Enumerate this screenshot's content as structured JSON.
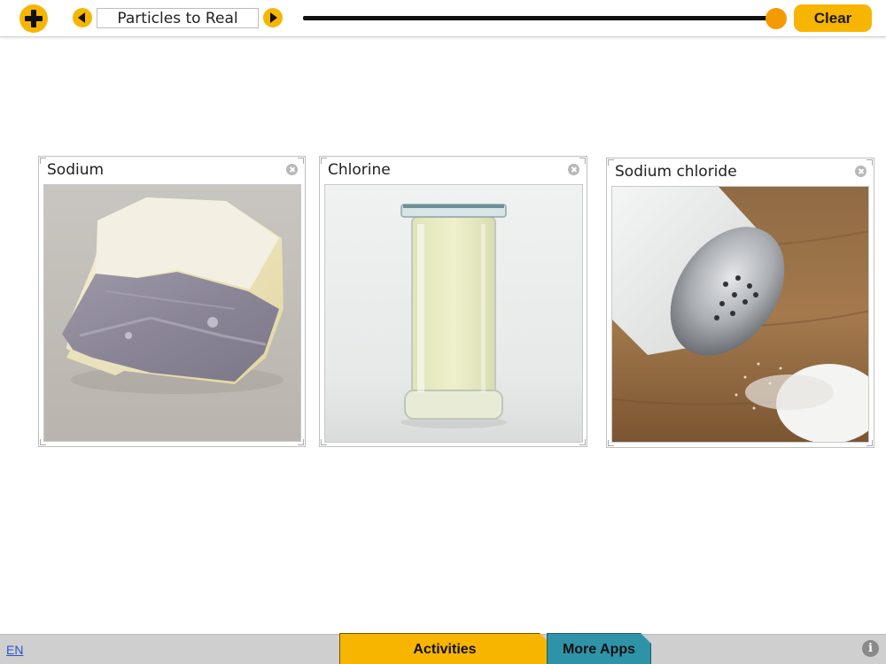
{
  "toolbar": {
    "add_icon": "plus-icon",
    "prev_icon": "triangle-left-icon",
    "next_icon": "triangle-right-icon",
    "title": "Particles to Real",
    "clear_label": "Clear",
    "slider_value": 1.0
  },
  "cards": [
    {
      "title": "Sodium",
      "image": "sodium-metal-photo"
    },
    {
      "title": "Chlorine",
      "image": "chlorine-gas-jar-photo"
    },
    {
      "title": "Sodium chloride",
      "image": "salt-shaker-photo"
    }
  ],
  "bottombar": {
    "language": "EN",
    "tab_activities": "Activities",
    "tab_more_apps": "More Apps",
    "info_icon": "info-icon"
  },
  "colors": {
    "accent": "#f7b500",
    "slider_thumb": "#f59a00",
    "tab_more_apps": "#2f93a8",
    "bottombar": "#cfcfcf"
  }
}
